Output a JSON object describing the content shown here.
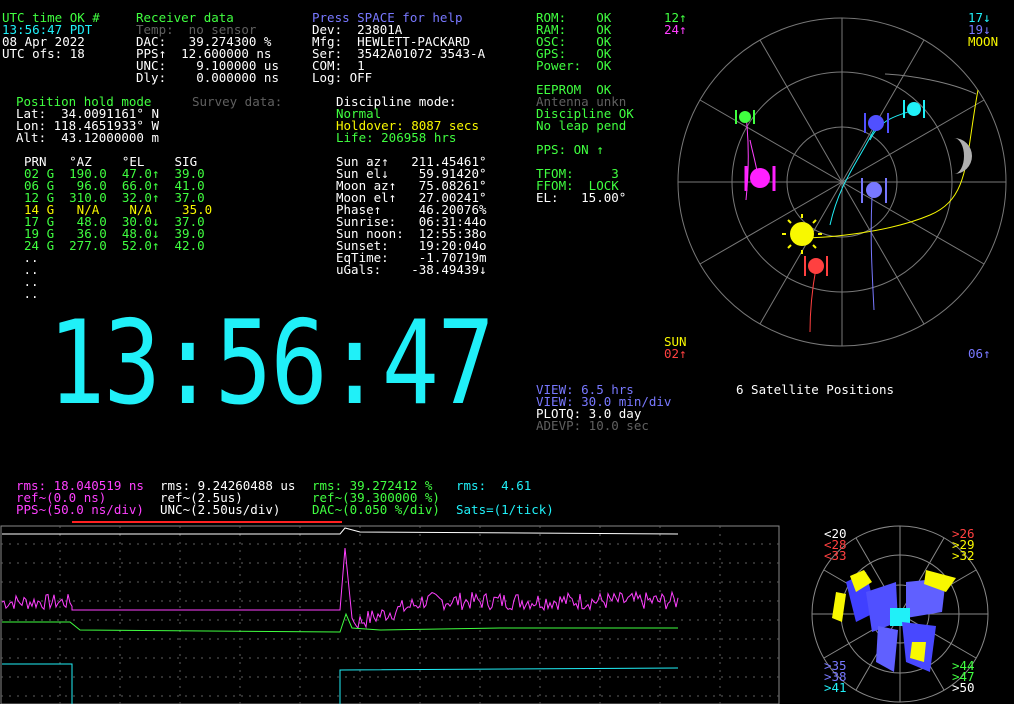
{
  "colors": {
    "cyan": "#20f0f8",
    "green": "#40ff40",
    "white": "#ffffff",
    "yellow": "#f8f800",
    "magenta": "#ff40ff",
    "gray": "#606060",
    "blue": "#7878ff",
    "red": "#ff4040"
  },
  "utc_block": {
    "title": "UTC time OK #",
    "time": "13:56:47 PDT",
    "date": "08 Apr 2022",
    "utc_ofs": "UTC ofs: 18"
  },
  "receiver": {
    "title": "Receiver data",
    "temp": "Temp:  no sensor",
    "dac": "DAC:   39.274300 %",
    "pps": "PPS↑  12.600000 ns",
    "unc": "UNC:    9.100000 us",
    "dly": "Dly:    0.000000 ns"
  },
  "device": {
    "help": "Press SPACE for help",
    "dev": "Dev:  23801A",
    "mfg": "Mfg:  HEWLETT-PACKARD",
    "ser": "Ser:  3542A01072 3543-A",
    "com": "COM:  1",
    "log": "Log: OFF"
  },
  "status": {
    "rom": "ROM:    OK",
    "ram": "RAM:    OK",
    "osc": "OSC:    OK",
    "gps": "GPS:    OK",
    "power": "Power:  OK",
    "eeprom": "EEPROM  OK",
    "antenna": "Antenna unkn",
    "discipline": "Discipline OK",
    "leap": "No leap pend",
    "pps_on": "PPS: ON ↑",
    "tfom": "TFOM:     3",
    "ffom": "FFOM:  LOCK",
    "el": "EL:   15.00°"
  },
  "position": {
    "title": "Position hold mode",
    "survey": "Survey data:",
    "lat": "Lat:  34.0091161° N",
    "lon": "Lon: 118.4651933° W",
    "alt": "Alt:  43.12000000 m"
  },
  "discipline": {
    "title": "Discipline mode:",
    "mode": "Normal",
    "holdover": "Holdover: 8087 secs",
    "life": "Life: 206958 hrs"
  },
  "sat_table": {
    "header": "PRN   °AZ    °EL    SIG",
    "rows": [
      {
        "text": "02 G  190.0  47.0↑  39.0",
        "color": "green"
      },
      {
        "text": "06 G   96.0  66.0↑  41.0",
        "color": "green"
      },
      {
        "text": "12 G  310.0  32.0↑  37.0",
        "color": "green"
      },
      {
        "text": "14 G   N/A    N/A    35.0",
        "color": "yellow"
      },
      {
        "text": "17 G   48.0  30.0↓  37.0",
        "color": "green"
      },
      {
        "text": "19 G   36.0  48.0↓  39.0",
        "color": "green"
      },
      {
        "text": "24 G  277.0  52.0↑  42.0",
        "color": "green"
      }
    ],
    "dots": [
      " ..",
      " ..",
      " ..",
      " .."
    ]
  },
  "astro": {
    "sun_az": "Sun az↑   211.45461°",
    "sun_el": "Sun el↓    59.91420°",
    "moon_az": "Moon az↑   75.08261°",
    "moon_el": "Moon el↑   27.00241°",
    "phase": "Phase↑     46.20076%",
    "sunrise": "Sunrise:   06:31:44o",
    "sun_noon": "Sun noon:  12:55:38o",
    "sunset": "Sunset:    19:20:04o",
    "eqtime": "EqTime:    -1.70719m",
    "ugals": "uGals:    -38.49439↓"
  },
  "big_clock": "13:56:47",
  "sky": {
    "title": "6 Satellite Positions",
    "tl1": "12↑",
    "tl2": "24↑",
    "tr1": "17↓",
    "tr2": "19↓",
    "tr3": "MOON",
    "bl1": "SUN",
    "bl2": "02↑",
    "br1": "06↑"
  },
  "view": {
    "v1": "VIEW: 6.5 hrs",
    "v2": "VIEW: 30.0 min/div",
    "plotq": "PLOTQ: 3.0 day",
    "adevp": "ADEVP: 10.0 sec"
  },
  "plot_header": {
    "rms1": "rms: 18.040519 ns",
    "rms2": "rms: 9.24260488 us",
    "rms3": "rms: 39.272412 %",
    "rms4": "rms:  4.61",
    "ref1": "ref~(0.0 ns)",
    "ref2": "ref~(2.5us)",
    "ref3": "ref~(39.300000 %)",
    "pps": "PPS~(50.0 ns/div)",
    "unc": "UNC~(2.50us/div)",
    "dac": "DAC~(0.050 %/div)",
    "sats": "Sats=(1/tick)"
  },
  "signal_map": {
    "tl": [
      "<20",
      "<28",
      "<33"
    ],
    "tr": [
      ">26",
      ">29",
      ">32"
    ],
    "bl": [
      ">35",
      ">38",
      ">41"
    ],
    "br": [
      ">44",
      ">47",
      ">50"
    ]
  }
}
